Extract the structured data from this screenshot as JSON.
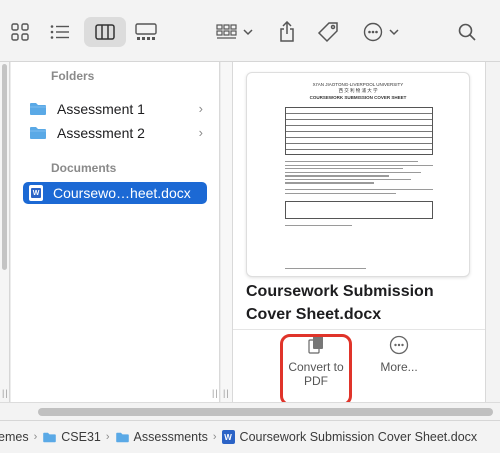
{
  "toolbar": {
    "icons": [
      "icon-view-icon",
      "list-view-icon",
      "column-view-icon",
      "gallery-view-icon",
      "group-icon",
      "share-icon",
      "tag-icon",
      "more-actions-icon",
      "search-icon"
    ],
    "active_view": "column"
  },
  "sidebar": {
    "folders_label": "Folders",
    "documents_label": "Documents",
    "folders": [
      {
        "label": "Assessment 1"
      },
      {
        "label": "Assessment 2"
      }
    ],
    "documents": [
      {
        "label": "Coursewo…heet.docx",
        "selected": true
      }
    ]
  },
  "preview": {
    "thumbnail_lines": {
      "line1": "XI'AN JIAOTONG-LIVERPOOL UNIVERSITY",
      "line2": "西 交 利 物 浦 大 学",
      "line3": "COURSEWORK SUBMISSION COVER SHEET"
    },
    "title": "Coursework Submission Cover Sheet.docx",
    "actions": [
      {
        "label": "Convert to PDF",
        "icon": "convert-pdf-icon"
      },
      {
        "label": "More...",
        "icon": "more-icon"
      }
    ]
  },
  "pathbar": {
    "segments": [
      "emes",
      "CSE31",
      "Assessments",
      "Coursework Submission Cover Sheet.docx"
    ]
  },
  "colors": {
    "selection": "#1c69d4",
    "highlight": "#e0342a",
    "folder": "#5aa9e6"
  }
}
